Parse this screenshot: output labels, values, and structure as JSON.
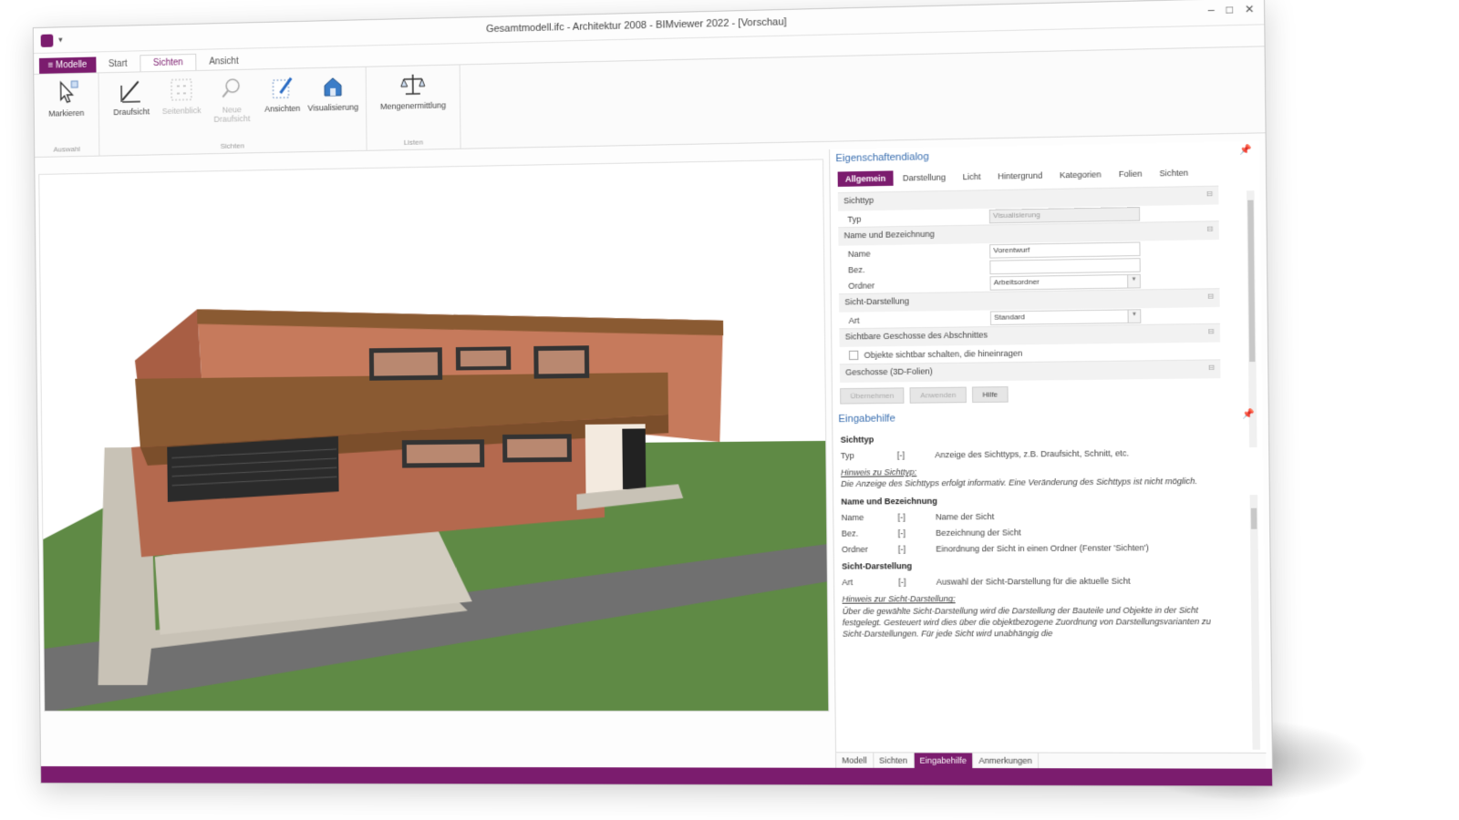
{
  "window": {
    "title": "Gesamtmodell.ifc - Architektur 2008 - BIMviewer 2022 - [Vorschau]",
    "controls": [
      "–",
      "□",
      "✕"
    ],
    "help_controls": [
      "^",
      "?",
      "-",
      "□",
      "✕"
    ]
  },
  "ribbon": {
    "file_tab": "≡ Modelle",
    "tabs": [
      "Start",
      "Sichten",
      "Ansicht"
    ],
    "active_tab": "Sichten",
    "groups": [
      {
        "label": "Auswahl",
        "buttons": [
          {
            "label": "Markieren",
            "icon": "cursor-icon",
            "enabled": true
          }
        ]
      },
      {
        "label": "Sichten",
        "buttons": [
          {
            "label": "Draufsicht",
            "icon": "pen-icon",
            "enabled": true
          },
          {
            "label": "Seitenblick",
            "icon": "dashed-grid-icon",
            "enabled": false
          },
          {
            "label": "Neue Draufsicht",
            "icon": "magnifier-icon",
            "enabled": false
          },
          {
            "label": "Ansichten",
            "icon": "pencil-plan-icon",
            "enabled": true
          },
          {
            "label": "Visualisierung",
            "icon": "house-cube-icon",
            "enabled": true
          }
        ]
      },
      {
        "label": "Listen",
        "buttons": [
          {
            "label": "Mengenermittlung",
            "icon": "scale-icon",
            "enabled": true
          }
        ]
      }
    ]
  },
  "properties": {
    "title": "Eigenschaftendialog",
    "tabs": [
      "Allgemein",
      "Darstellung",
      "Licht",
      "Hintergrund",
      "Kategorien",
      "Folien",
      "Sichten"
    ],
    "active_tab": "Allgemein",
    "sections": [
      {
        "name": "Sichttyp",
        "rows": [
          {
            "label": "Typ",
            "value": "Visualisierung",
            "readonly": true,
            "dropdown": false
          }
        ]
      },
      {
        "name": "Name und Bezeichnung",
        "rows": [
          {
            "label": "Name",
            "value": "Vorentwurf",
            "readonly": false,
            "dropdown": false
          },
          {
            "label": "Bez.",
            "value": "",
            "readonly": false,
            "dropdown": false
          },
          {
            "label": "Ordner",
            "value": "Arbeitsordner",
            "readonly": false,
            "dropdown": true
          }
        ]
      },
      {
        "name": "Sicht-Darstellung",
        "rows": [
          {
            "label": "Art",
            "value": "Standard",
            "readonly": false,
            "dropdown": true
          }
        ]
      },
      {
        "name": "Sichtbare Geschosse des Abschnittes",
        "checkbox": "Objekte sichtbar schalten, die hineinragen"
      },
      {
        "name": "Geschosse (3D-Folien)"
      }
    ],
    "buttons": [
      "Übernehmen",
      "Anwenden",
      "Hilfe"
    ]
  },
  "helppanel": {
    "title": "Eingabehilfe",
    "blocks": [
      {
        "heading": "Sichttyp",
        "rows": [
          {
            "k": "Typ",
            "u": "[-]",
            "d": "Anzeige des Sichttyps, z.B. Draufsicht, Schnitt, etc."
          }
        ],
        "hint_title": "Hinweis zu Sichttyp:",
        "hint": "Die Anzeige des Sichttyps erfolgt informativ. Eine Veränderung des Sichttyps ist nicht möglich."
      },
      {
        "heading": "Name und Bezeichnung",
        "rows": [
          {
            "k": "Name",
            "u": "[-]",
            "d": "Name der Sicht"
          },
          {
            "k": "Bez.",
            "u": "[-]",
            "d": "Bezeichnung der Sicht"
          },
          {
            "k": "Ordner",
            "u": "[-]",
            "d": "Einordnung der Sicht in einen Ordner (Fenster 'Sichten')"
          }
        ]
      },
      {
        "heading": "Sicht-Darstellung",
        "rows": [
          {
            "k": "Art",
            "u": "[-]",
            "d": "Auswahl der Sicht-Darstellung für die aktuelle Sicht"
          }
        ],
        "hint_title": "Hinweis zur Sicht-Darstellung:",
        "hint": "Über die gewählte Sicht-Darstellung wird die Darstellung der Bauteile und Objekte in der Sicht festgelegt. Gesteuert wird dies über die objektbezogene Zuordnung von Darstellungsvarianten zu Sicht-Darstellungen. Für jede Sicht wird unabhängig die"
      }
    ],
    "bottom_tabs": [
      "Modell",
      "Sichten",
      "Eingabehilfe",
      "Anmerkungen"
    ],
    "active_bottom_tab": "Eingabehilfe"
  },
  "colors": {
    "accent": "#7b1c6e",
    "link": "#3a6fb0",
    "wall": "#c67a5c",
    "roof_band": "#8a5a32",
    "grass": "#5f8a45",
    "pavement": "#c8c2b6",
    "road": "#707070"
  }
}
